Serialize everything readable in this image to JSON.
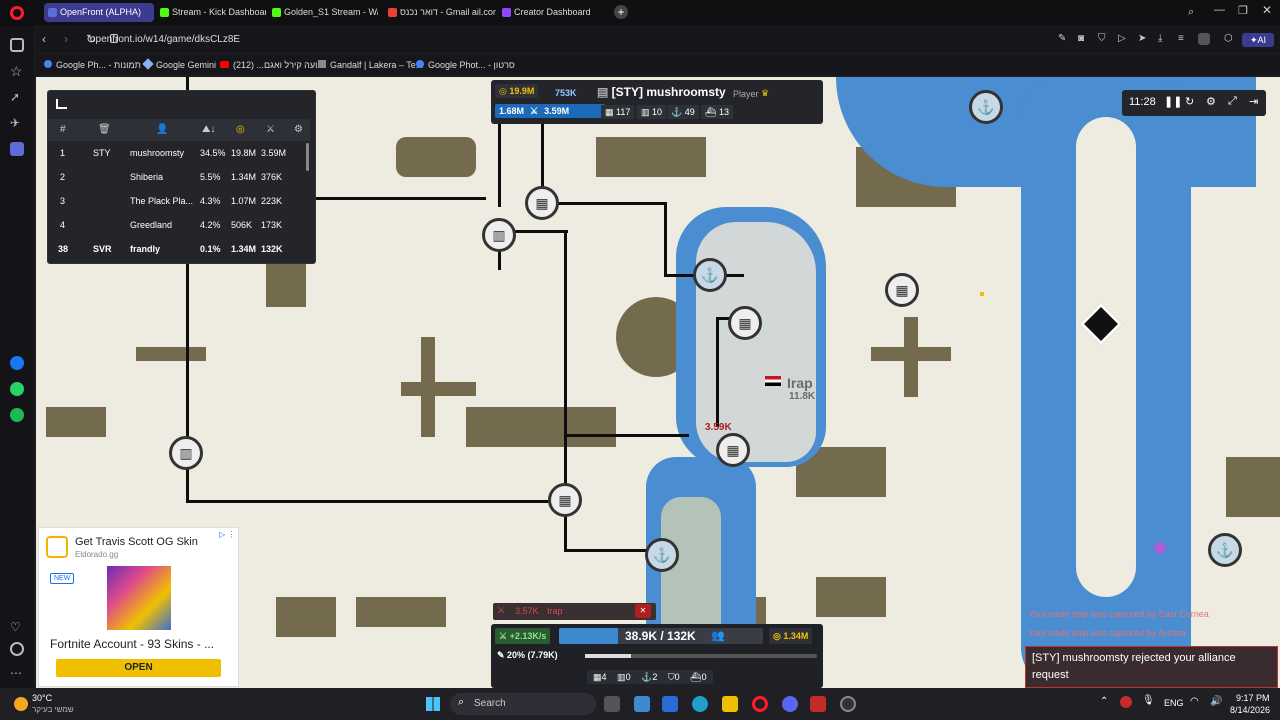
{
  "browser": {
    "tabs": [
      {
        "label": "OpenFront (ALPHA)",
        "active": true,
        "color": "#5f6bd8"
      },
      {
        "label": "Stream - Kick Dashboard",
        "color": "#53fc18"
      },
      {
        "label": "Golden_S1 Stream - Watc",
        "color": "#53fc18"
      },
      {
        "label": "דואר נכנס - Gmail ail.com",
        "color": "#ea4335"
      },
      {
        "label": "Creator Dashboard",
        "color": "#9146ff"
      }
    ],
    "url": "openfront.io/w14/game/dksCLz8E",
    "bookmarks": [
      "Google Ph... - תמונות",
      "Google Gemini",
      "נועה קירל ואגם... (212)",
      "Gandalf | Lakera – Te...",
      "Google Phot... - סרטון"
    ]
  },
  "leaderboard": {
    "headers": [
      "#",
      "",
      "",
      "",
      "",
      "",
      ""
    ],
    "rows": [
      {
        "rank": "1",
        "tag": "STY",
        "name": "mushroomsty",
        "pct": "34.5%",
        "gold": "19.8M",
        "troops": "3.59M"
      },
      {
        "rank": "2",
        "tag": "",
        "name": "Shiberia",
        "pct": "5.5%",
        "gold": "1.34M",
        "troops": "376K"
      },
      {
        "rank": "3",
        "tag": "",
        "name": "The Plack Pla...",
        "pct": "4.3%",
        "gold": "1.07M",
        "troops": "223K"
      },
      {
        "rank": "4",
        "tag": "",
        "name": "Greedland",
        "pct": "4.2%",
        "gold": "506K",
        "troops": "173K"
      },
      {
        "rank": "38",
        "tag": "SVR",
        "name": "frandly",
        "pct": "0.1%",
        "gold": "1.34M",
        "troops": "132K"
      }
    ]
  },
  "player": {
    "gold": "19.9M",
    "troops_top": "753K",
    "workers": "1.68M",
    "troops": "3.59M",
    "name": "[STY] mushroomsty",
    "role": "Player",
    "cities": "117",
    "factories": "10",
    "ports": "49",
    "warships": "13"
  },
  "timer": {
    "time": "11:28"
  },
  "map": {
    "label_city": "Irap",
    "label_city_troops": "11.8K",
    "attack_label": "3.59K"
  },
  "attack_bar": {
    "troops": "3.57K",
    "target": "Irap"
  },
  "control": {
    "rate": "+2.13K/s",
    "troops": "38.9K / 132K",
    "gold": "1.34M",
    "ratio": "20% (7.79K)",
    "ratio_fill": 0.2,
    "troop_fill": 0.29,
    "counts": [
      "4",
      "0",
      "2",
      "0",
      "0"
    ]
  },
  "notifications": [
    "Your trade ship was captured by East Cornea",
    "Your trade ship was captured by Arctica"
  ],
  "alliance_msg": "[STY] mushroomsty rejected your alliance request",
  "ad": {
    "title": "Get Travis Scott OG Skin",
    "source": "Eldorado.gg",
    "badge": "NEW",
    "headline": "Fortnite Account - 93 Skins - ...",
    "cta": "OPEN"
  },
  "taskbar": {
    "weather_temp": "30°C",
    "weather_text": "שמשי בעיקר",
    "search": "Search",
    "lang": "ENG",
    "time": "9:17 PM",
    "date": "8/14/2026"
  }
}
